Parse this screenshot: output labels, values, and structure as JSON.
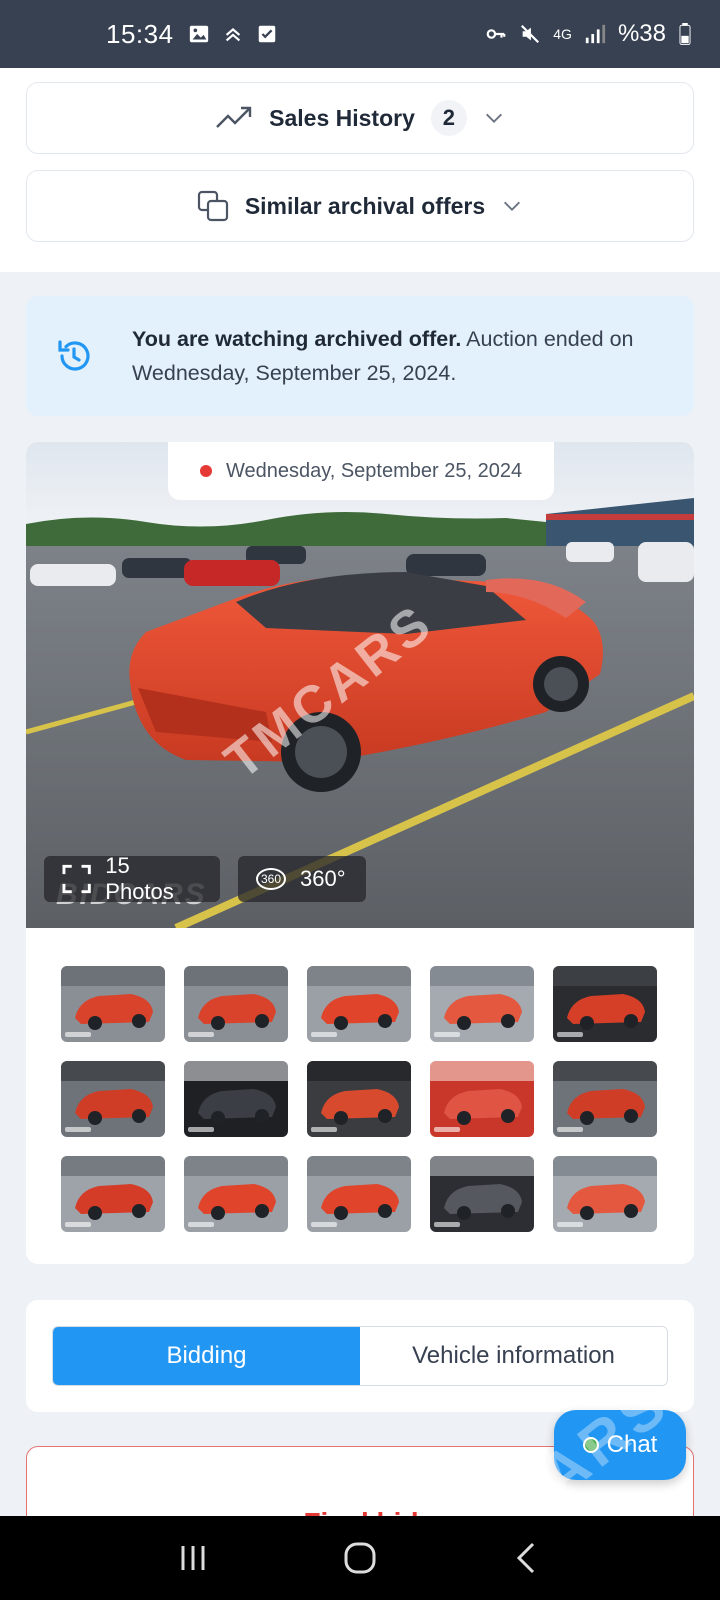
{
  "status_bar": {
    "time": "15:34",
    "battery": "%38",
    "network": "4G"
  },
  "sales_history": {
    "label": "Sales History",
    "count": "2"
  },
  "similar_offers": {
    "label": "Similar archival offers"
  },
  "notice": {
    "bold": "You are watching archived offer.",
    "rest": " Auction ended on Wednesday, September 25, 2024."
  },
  "gallery": {
    "date": "Wednesday, September 25, 2024",
    "photos_label": "15 Photos",
    "view360_label": "360°",
    "view360_badge": "360",
    "watermark": "TMCARS",
    "source_mark": "BIDCARS",
    "thumbs": [
      "car-front-damage",
      "car-front-damage",
      "car-side",
      "car-rear",
      "interior-door",
      "engine-bay",
      "dashboard",
      "rear-seat",
      "vin-label",
      "engine-bay",
      "front-crash",
      "car-side",
      "car-side",
      "instrument-cluster",
      "car-rear"
    ]
  },
  "tabs": {
    "bidding": "Bidding",
    "vehicle_info": "Vehicle information"
  },
  "final_bid": "Final bid",
  "chat": "Chat",
  "colors": {
    "accent": "#2196f3",
    "status_bar": "#374151",
    "notice_bg": "#e3f1fc",
    "alert_red": "#e53935",
    "car_body": "#e0442a"
  }
}
